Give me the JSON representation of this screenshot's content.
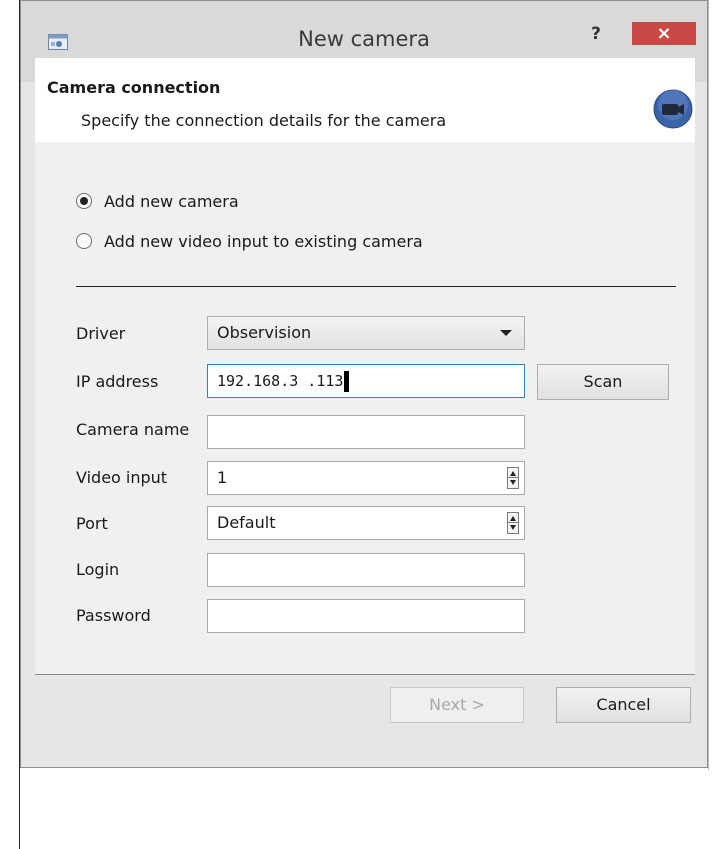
{
  "window": {
    "title": "New camera",
    "help_label": "?",
    "close_label": "×"
  },
  "header": {
    "title": "Camera connection",
    "subtitle": "Specify the connection details for the camera"
  },
  "options": [
    {
      "label": "Add new camera",
      "checked": true
    },
    {
      "label": "Add new video input to existing camera",
      "checked": false
    }
  ],
  "fields": {
    "driver": {
      "label": "Driver",
      "value": "Observision"
    },
    "ip": {
      "label": "IP address",
      "value": "192.168.3 .113"
    },
    "camera_name": {
      "label": "Camera name",
      "value": ""
    },
    "video_input": {
      "label": "Video input",
      "value": "1"
    },
    "port": {
      "label": "Port",
      "value": "Default"
    },
    "login": {
      "label": "Login",
      "value": ""
    },
    "password": {
      "label": "Password",
      "value": ""
    }
  },
  "buttons": {
    "scan": "Scan",
    "next": "Next >",
    "cancel": "Cancel"
  },
  "colors": {
    "close": "#c94a44",
    "camera_icon": "#3b63a8",
    "focus": "#3c7fb1"
  }
}
